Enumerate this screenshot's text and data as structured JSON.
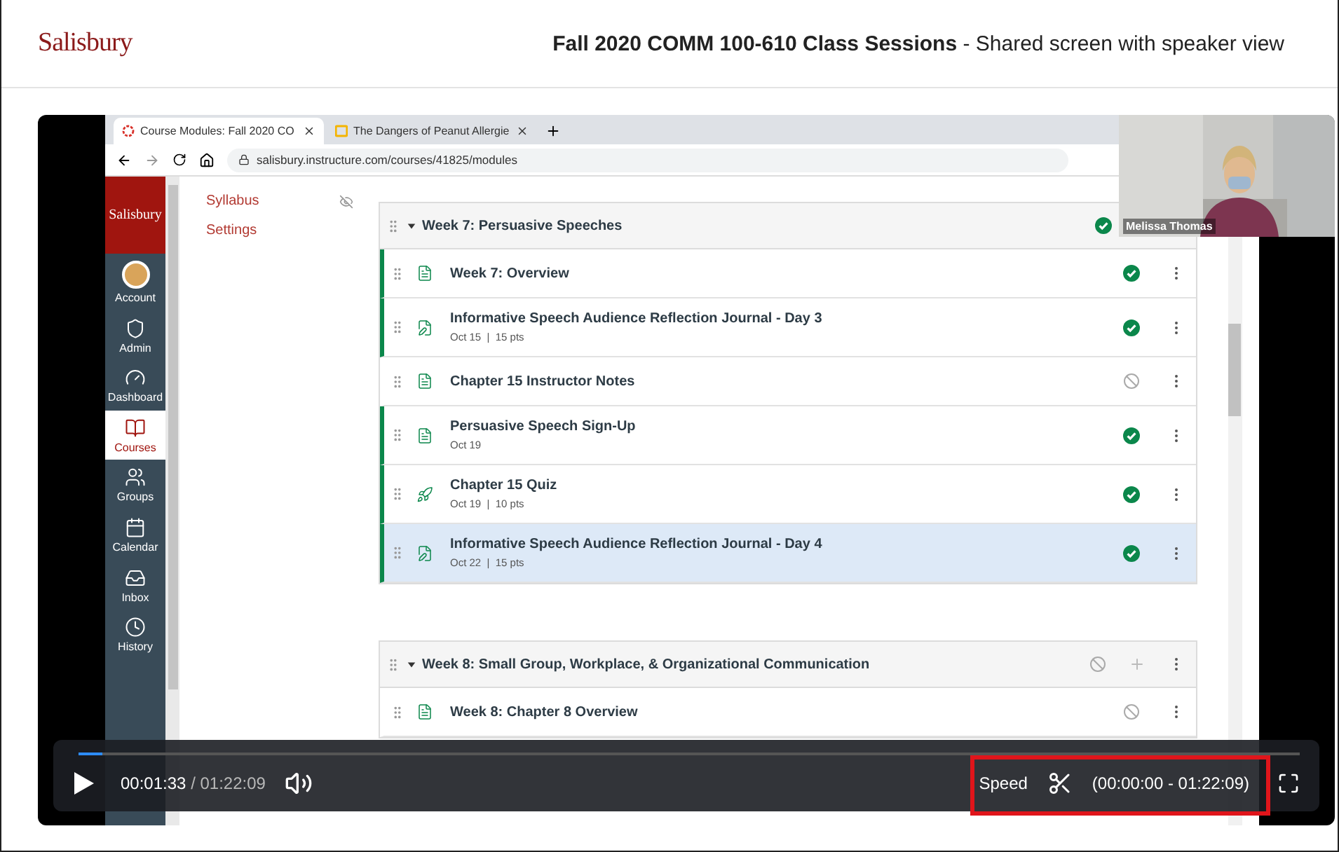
{
  "header": {
    "logo": "Salisbury",
    "title": "**Fall 2020 COMM 100-610 Class Sessions** - Shared screen with speaker view"
  },
  "browser": {
    "tabs": [
      {
        "label": "Course Modules: Fall 2020 CO",
        "selected": true
      },
      {
        "label": "The Dangers of Peanut Allergie",
        "selected": false
      }
    ],
    "url": "salisbury.instructure.com/courses/41825/modules"
  },
  "canvas_nav": {
    "logo": "Salisbury",
    "items": [
      {
        "label": "Account",
        "kind": "account",
        "selected": false
      },
      {
        "label": "Admin",
        "kind": "admin",
        "selected": false
      },
      {
        "label": "Dashboard",
        "kind": "dashboard",
        "selected": false
      },
      {
        "label": "Courses",
        "kind": "courses",
        "selected": true
      },
      {
        "label": "Groups",
        "kind": "groups",
        "selected": false
      },
      {
        "label": "Calendar",
        "kind": "calendar",
        "selected": false
      },
      {
        "label": "Inbox",
        "kind": "inbox",
        "selected": false
      },
      {
        "label": "History",
        "kind": "history",
        "selected": false
      }
    ]
  },
  "course_nav": [
    {
      "label": "Syllabus",
      "hidden": true
    },
    {
      "label": "Settings",
      "hidden": false
    }
  ],
  "modules": [
    {
      "title": "Week 7: Persuasive Speeches",
      "published": true,
      "actions": false,
      "items": [
        {
          "title": "Week 7: Overview",
          "kind": "page",
          "published": true,
          "selected": false
        },
        {
          "title": "Informative Speech Audience Reflection Journal - Day 3",
          "kind": "assignment",
          "meta": "Oct 15  |  15 pts",
          "published": true,
          "selected": false
        },
        {
          "title": "Chapter 15 Instructor Notes",
          "kind": "page",
          "published": false,
          "selected": false
        },
        {
          "title": "Persuasive Speech Sign-Up",
          "kind": "page",
          "meta": "Oct 19",
          "published": true,
          "selected": false
        },
        {
          "title": "Chapter 15 Quiz",
          "kind": "quiz",
          "meta": "Oct 19  |  10 pts",
          "published": true,
          "selected": false
        },
        {
          "title": "Informative Speech Audience Reflection Journal - Day 4",
          "kind": "assignment",
          "meta": "Oct 22  |  15 pts",
          "published": true,
          "selected": true
        }
      ]
    },
    {
      "title": "Week 8: Small Group, Workplace, & Organizational Communication",
      "published": false,
      "actions": true,
      "items": [
        {
          "title": "Week 8: Chapter 8 Overview",
          "kind": "page",
          "published": false,
          "selected": false
        }
      ]
    }
  ],
  "webcam": {
    "name": "Melissa Thomas"
  },
  "player": {
    "current": "00:01:33",
    "separator": "/",
    "duration": "01:22:09",
    "level": 0.02,
    "speed": "Speed",
    "clip": "(00:00:00 - 01:22:09)"
  }
}
